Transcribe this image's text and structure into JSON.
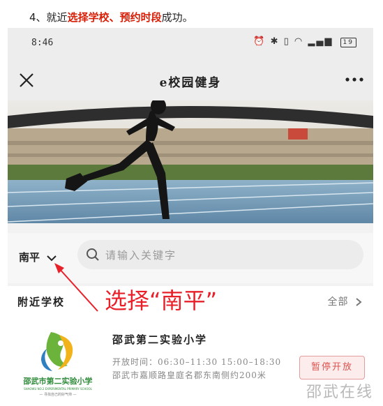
{
  "step": {
    "number": "4、",
    "prefix": "就近",
    "highlight": "选择学校、预约时段",
    "suffix": "成功。"
  },
  "status_bar": {
    "time": "8:46",
    "icons": [
      "alarm-icon",
      "bluetooth-icon",
      "vibrate-icon",
      "wifi-icon",
      "signal-icon"
    ],
    "battery": "19"
  },
  "nav": {
    "title": "e校园健身",
    "close_icon": "close-icon",
    "more_icon": "more-icon"
  },
  "search": {
    "city": "南平",
    "placeholder": "请输入关键字"
  },
  "nearby": {
    "title": "附近学校",
    "view_all": "全部"
  },
  "school": {
    "name": "邵武第二实验小学",
    "hours_label": "开放时间：",
    "hours_value": "06:30–11:30 15:00–18:30",
    "address": "邵武市嘉顺路皇庭名郡东南侧约200米",
    "status": "暂停开放",
    "logo_text_cn": "邵武市第二实验小学",
    "logo_text_en": "SHAOWU NO.2 EXPERIMENTAL PRIMARY SCHOOL",
    "logo_motto": "— 寻找自己的好气帅 —"
  },
  "annotation": {
    "text": "选择“南平”"
  },
  "watermark": "邵武在线",
  "colors": {
    "highlight_red": "#d81e06",
    "annotation_red": "#e8202a",
    "status_red": "#d9534f"
  }
}
